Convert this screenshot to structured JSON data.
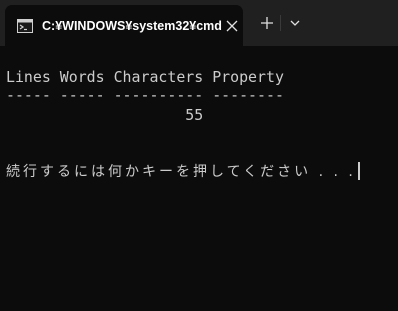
{
  "tab": {
    "icon": "cmd-icon",
    "title": "C:¥WINDOWS¥system32¥cmd",
    "close_icon": "close-icon"
  },
  "titlebar": {
    "new_tab_icon": "plus-icon",
    "dropdown_icon": "chevron-down-icon"
  },
  "console": {
    "header": "Lines Words Characters Property",
    "underline": "----- ----- ---------- --------",
    "value_line": "                    55",
    "prompt": "続行するには何かキーを押してください . . ."
  },
  "colors": {
    "background": "#0c0c0c",
    "titlebar": "#202020",
    "text": "#cccccc"
  }
}
